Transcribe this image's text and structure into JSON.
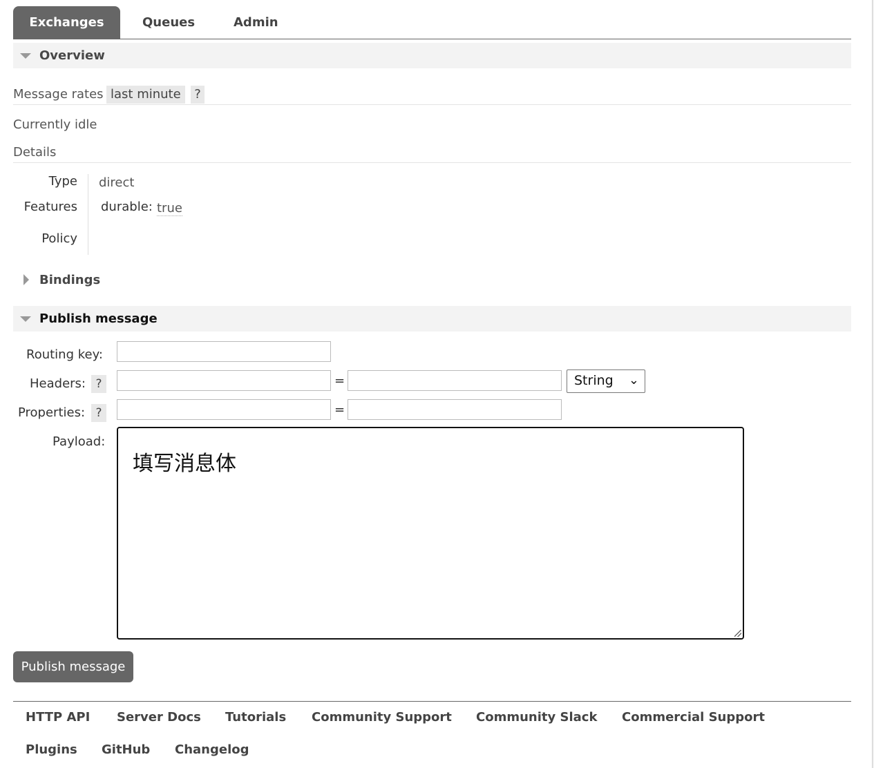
{
  "tabs": [
    {
      "label": "Exchanges",
      "active": true
    },
    {
      "label": "Queues",
      "active": false
    },
    {
      "label": "Admin",
      "active": false
    }
  ],
  "overview": {
    "title": "Overview",
    "message_rates_label": "Message rates",
    "rates_range": "last minute",
    "help": "?",
    "status": "Currently idle",
    "details_title": "Details",
    "type_label": "Type",
    "type_value": "direct",
    "features_label": "Features",
    "durable_key": "durable:",
    "durable_value": "true",
    "policy_label": "Policy"
  },
  "bindings": {
    "title": "Bindings"
  },
  "publish": {
    "title": "Publish message",
    "routing_key_label": "Routing key:",
    "headers_label": "Headers:",
    "properties_label": "Properties:",
    "help": "?",
    "equals": "=",
    "header_type": "String",
    "payload_label": "Payload:",
    "payload_value": "填写消息体",
    "button_label": "Publish message"
  },
  "footer": {
    "row1": [
      "HTTP API",
      "Server Docs",
      "Tutorials",
      "Community Support",
      "Community Slack",
      "Commercial Support"
    ],
    "row2": [
      "Plugins",
      "GitHub",
      "Changelog"
    ]
  },
  "colors": {
    "tab_active_bg": "#666666",
    "section_bg": "#f3f3f3",
    "help_bg": "#e8e8e8"
  }
}
